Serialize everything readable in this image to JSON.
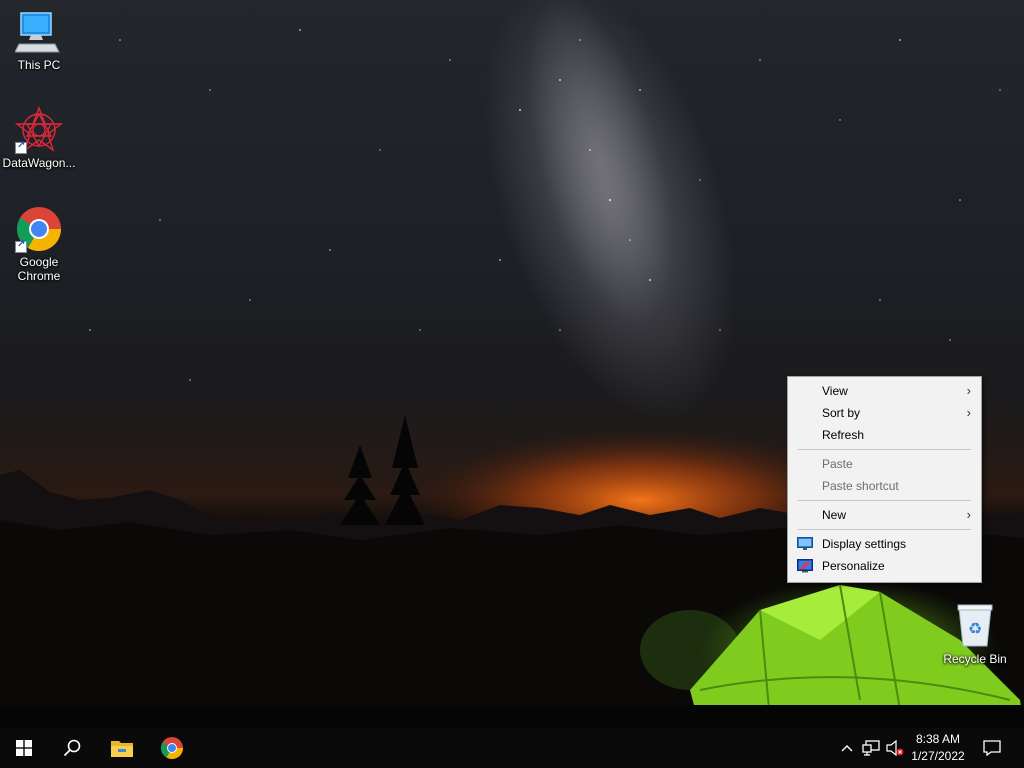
{
  "desktop": {
    "icons": [
      {
        "label": "This PC",
        "icon": "computer-icon"
      },
      {
        "label": "DataWagon...",
        "icon": "datawagon-icon"
      },
      {
        "label": "Google\nChrome",
        "label_line1": "Google",
        "label_line2": "Chrome",
        "icon": "chrome-icon"
      },
      {
        "label": "Recycle Bin",
        "icon": "recycle-bin-icon"
      }
    ]
  },
  "context_menu": {
    "items": [
      {
        "label": "View",
        "has_submenu": true
      },
      {
        "label": "Sort by",
        "has_submenu": true
      },
      {
        "label": "Refresh"
      },
      {
        "label": "Paste",
        "disabled": true
      },
      {
        "label": "Paste shortcut",
        "disabled": true
      },
      {
        "label": "New",
        "has_submenu": true
      },
      {
        "label": "Display settings",
        "icon": "display-icon"
      },
      {
        "label": "Personalize",
        "icon": "personalize-icon"
      }
    ]
  },
  "taskbar": {
    "clock_time": "8:38 AM",
    "clock_date": "1/27/2022",
    "pinned": [
      "file-explorer-icon",
      "chrome-icon"
    ]
  },
  "colors": {
    "taskbar": "#0a0a0a",
    "menu_bg": "#f2f2f2",
    "tent": "#8fdc2a"
  }
}
